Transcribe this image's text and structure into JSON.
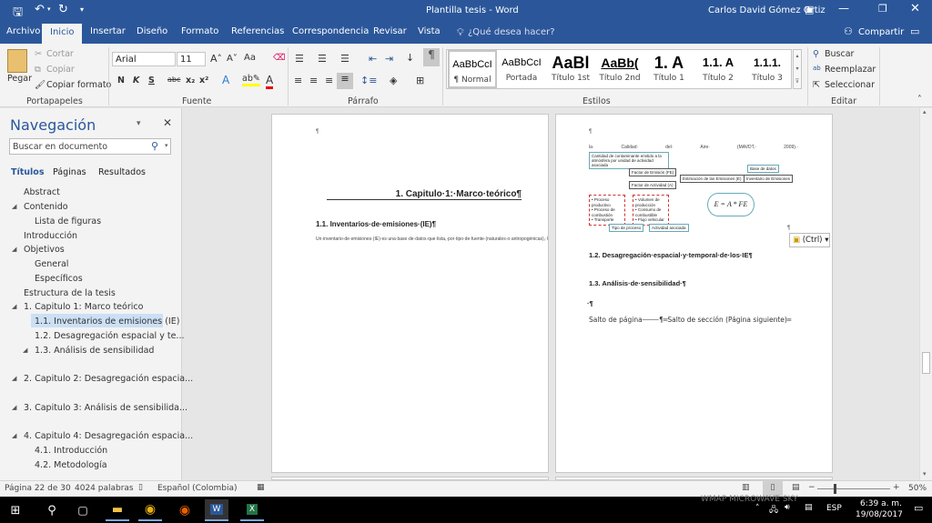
{
  "titlebar": {
    "doc_title": "Plantilla tesis  -  Word",
    "user": "Carlos David Gómez Ortiz"
  },
  "tabs": [
    {
      "label": "Archivo"
    },
    {
      "label": "Inicio",
      "active": true
    },
    {
      "label": "Insertar"
    },
    {
      "label": "Diseño"
    },
    {
      "label": "Formato"
    },
    {
      "label": "Referencias"
    },
    {
      "label": "Correspondencia"
    },
    {
      "label": "Revisar"
    },
    {
      "label": "Vista"
    }
  ],
  "tell_me": "¿Qué desea hacer?",
  "share": "Compartir",
  "clipboard": {
    "paste": "Pegar",
    "cut": "Cortar",
    "copy": "Copiar",
    "format_painter": "Copiar formato",
    "label": "Portapapeles"
  },
  "font": {
    "name": "Arial",
    "size": "11",
    "label": "Fuente",
    "bold": "N",
    "italic": "K",
    "underline": "S",
    "strike": "abc",
    "change_case": "Aa"
  },
  "paragraph": {
    "label": "Párrafo"
  },
  "styles": {
    "label": "Estilos",
    "items": [
      {
        "preview": "AaBbCcI",
        "name": "¶ Normal"
      },
      {
        "preview": "AaBbCcI",
        "name": "Portada"
      },
      {
        "preview": "AaBl",
        "name": "Título 1st"
      },
      {
        "preview": "AaBb(",
        "name": "Título 2nd"
      },
      {
        "preview": "1.  A",
        "name": "Título 1"
      },
      {
        "preview": "1.1.  A",
        "name": "Título 2"
      },
      {
        "preview": "1.1.1.",
        "name": "Título 3"
      }
    ]
  },
  "editing": {
    "label": "Editar",
    "find": "Buscar",
    "replace": "Reemplazar",
    "select": "Seleccionar"
  },
  "nav": {
    "title": "Navegación",
    "search_placeholder": "Buscar en documento",
    "tabs": [
      "Títulos",
      "Páginas",
      "Resultados"
    ],
    "items": [
      {
        "label": "Abstract"
      },
      {
        "label": "Contenido"
      },
      {
        "label": "Lista de figuras"
      },
      {
        "label": "Introducción"
      },
      {
        "label": "Objetivos"
      },
      {
        "label": "General"
      },
      {
        "label": "Específicos"
      },
      {
        "label": "Estructura de la tesis"
      },
      {
        "label": "1. Capitulo 1: Marco teórico"
      },
      {
        "label": "1.1. Inventarios de emisiones (IE)",
        "selected": true
      },
      {
        "label": "1.2. Desagregación espacial y te..."
      },
      {
        "label": "1.3. Análisis de sensibilidad"
      },
      {
        "label": "2. Capitulo 2: Desagregación espacia..."
      },
      {
        "label": "3. Capitulo 3: Análisis de sensibilida..."
      },
      {
        "label": "4. Capitulo 4: Desagregación espacia..."
      },
      {
        "label": "4.1. Introducción"
      },
      {
        "label": "4.2. Metodología"
      }
    ]
  },
  "page1": {
    "mark": "¶",
    "chapter": "1. Capitulo·1:·Marco·teórico¶",
    "h11": "1.1. Inventarios·de·emisiones·(IE)¶",
    "body": "Un·inventario·de·emisiones·(IE)·es·una·base·de·datos·que·lista,·por·tipo·de·fuente·(naturales·o·antropogénicas),·la·cantidad·de·contaminantes·emitidos·a·la·atmósfera·de·una·zona·(local,·regional·o·global)·durante·un·periodo·de·tiempo·determinado·(pasado,·presente·o·futuro)·(Parra·et·al.,·2006;·US·EPA,·n.d.).·Los·inventarios·de·emisiones·son·un·instrumento·clave·en·el·estudio·del·estado·de·la·calidad·del·aire·en·centros·urbanos·y,·además,·son·una·de·las·herramientas·técnicas·de·apoyo·para·la·construcción·de·los·Planes·de·Gestión·de"
  },
  "page2": {
    "mark": "¶",
    "line": [
      "la·",
      "Calidad·",
      "del·",
      "Aire·",
      "(MAVDT,·",
      "2009).·"
    ],
    "diagram": {
      "def": "Cantidad de contaminante emitido a la atmósfera por unidad de actividad asociada",
      "fe": "Factor de Emisión (FE)",
      "fa": "Factor de Actividad (A)",
      "est": "Estimación de las Emisiones (E)",
      "inv": "Inventario de Emisiones",
      "db": "Base de datos",
      "proc": [
        "Proceso productivo",
        "Proceso de combustión",
        "Transporte"
      ],
      "act": [
        "Volumen de producción",
        "Consumo de combustible",
        "Flujo vehicular"
      ],
      "tipo": "Tipo de proceso",
      "asoc": "Actividad asociada",
      "formula": "E = A * FE"
    },
    "paste_ctrl": "(Ctrl)",
    "h12": "1.2. Desagregación·espacial·y·temporal·de·los·IE¶",
    "h13": "1.3. Análisis·de·sensibilidad·¶",
    "pilcrow": "·¶",
    "breaks": "Salto de página⸻¶═Salto de sección (Página siguiente)═"
  },
  "status": {
    "page": "Página 22 de 30",
    "words": "4024 palabras",
    "language": "Español (Colombia)",
    "zoom": "50%",
    "zoom_percent": 50
  },
  "taskbar": {
    "watermark": "WMAP MICROWAVE SKY",
    "lang": "ESP",
    "time": "6:39 a. m.",
    "date": "19/08/2017"
  },
  "colors": {
    "word_blue": "#2b579a",
    "selection": "#cce0f5"
  }
}
